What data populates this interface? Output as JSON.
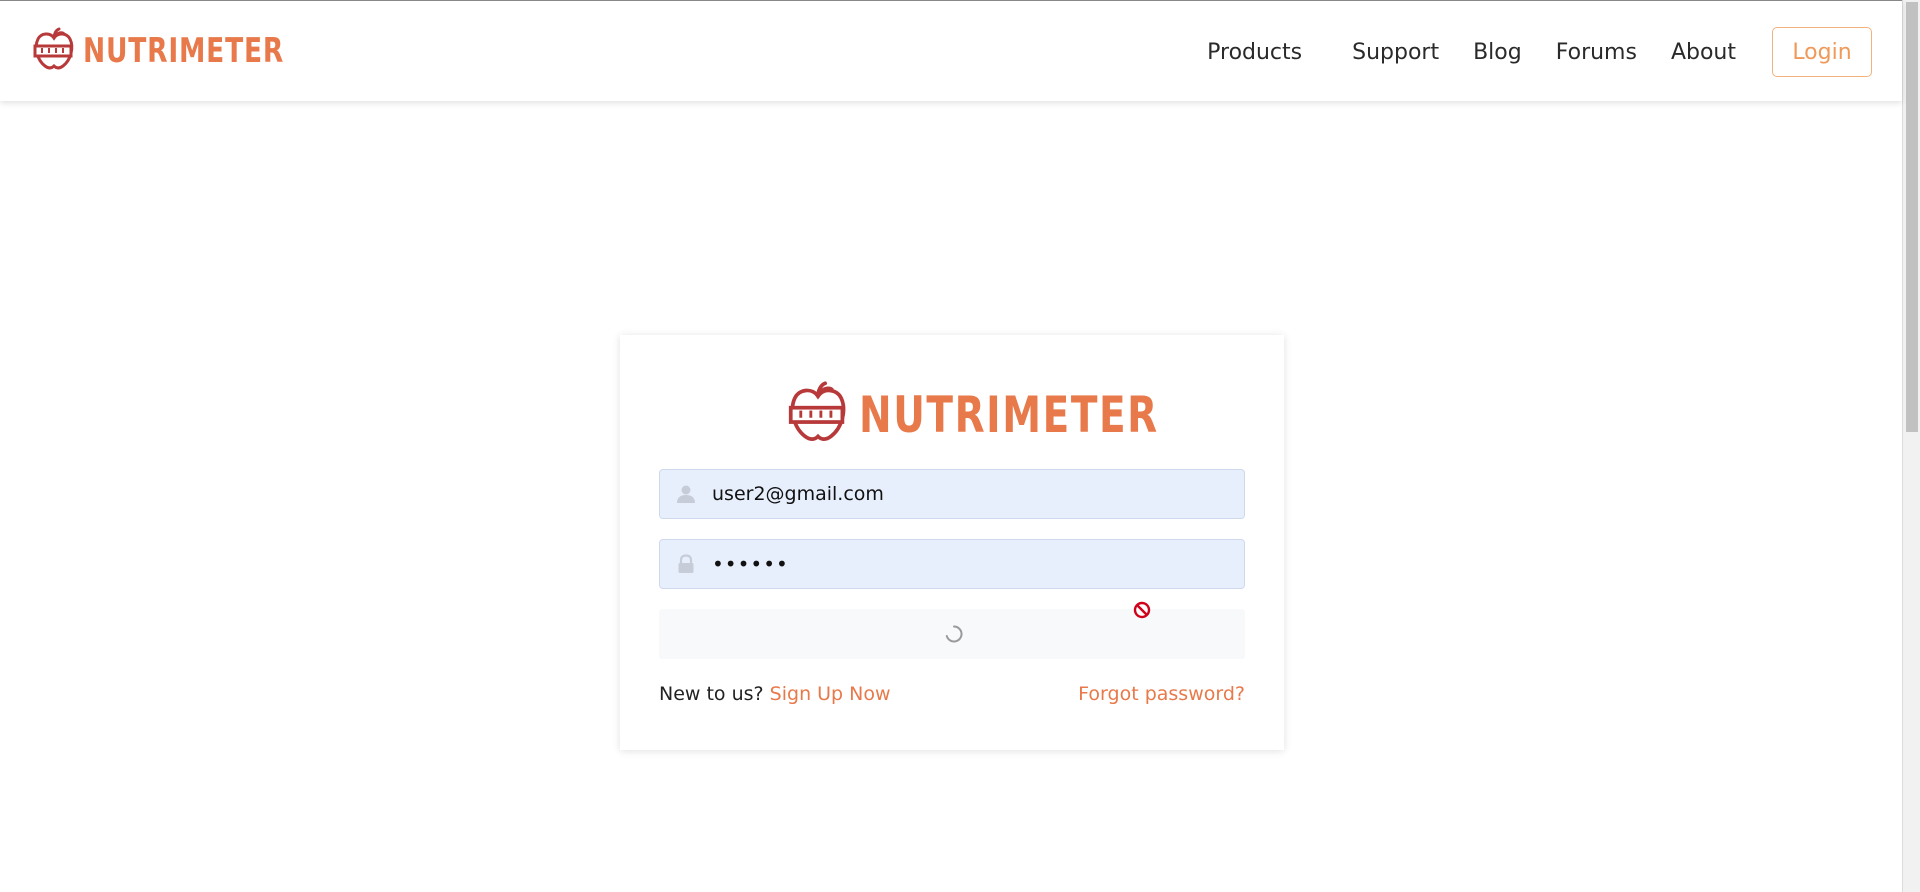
{
  "header": {
    "brand_name": "NUTRIMETER",
    "nav": {
      "products": "Products",
      "support": "Support",
      "blog": "Blog",
      "forums": "Forums",
      "about": "About"
    },
    "login_label": "Login"
  },
  "login_card": {
    "brand_name": "NUTRIMETER",
    "email": {
      "value": "user2@gmail.com",
      "icon": "user-icon"
    },
    "password": {
      "value": "••••••",
      "icon": "lock-icon"
    },
    "submit": {
      "state": "loading",
      "icon": "spinner-icon"
    },
    "cursor_icon": "not-allowed-icon",
    "new_user_text": "New to us?",
    "sign_up_label": "Sign Up Now",
    "forgot_label": "Forgot password?"
  },
  "colors": {
    "brand_orange": "#e8794a",
    "brand_red": "#b8393a",
    "login_border": "#f2b27e",
    "field_bg": "#e8effc"
  }
}
